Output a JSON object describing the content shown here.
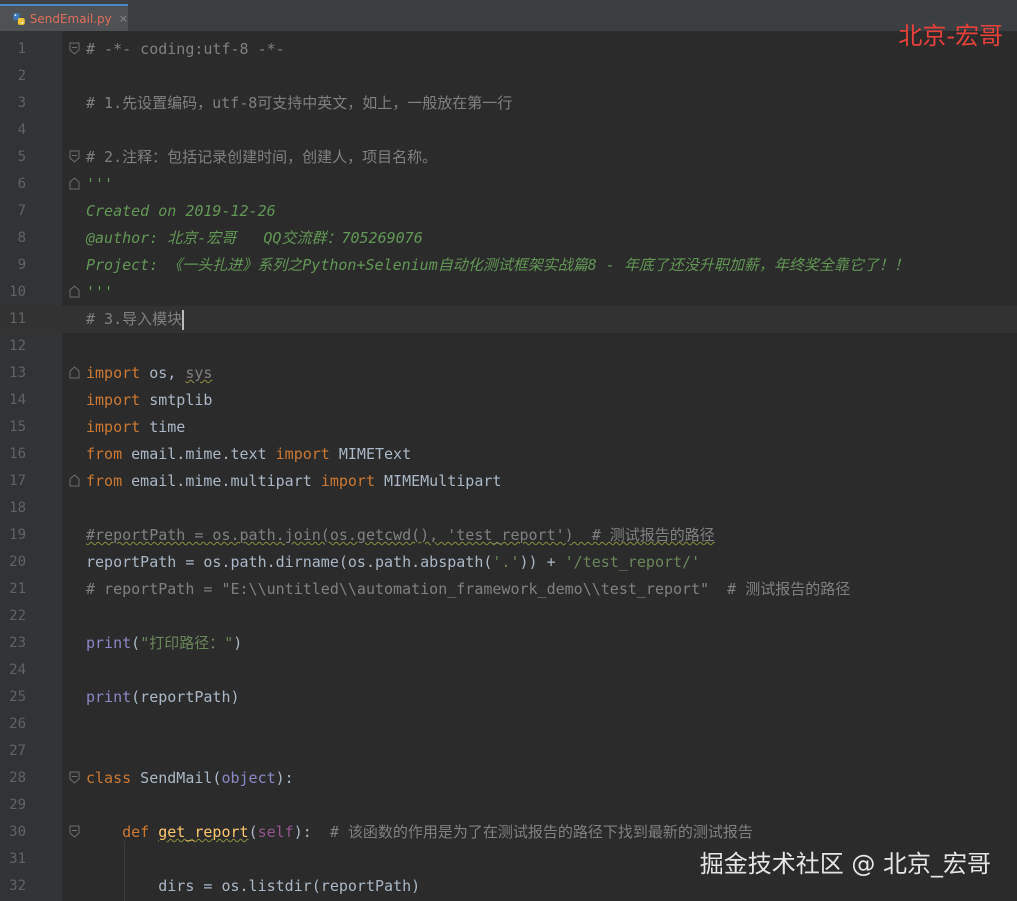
{
  "tab": {
    "filename": "SendEmail.py",
    "close": "×",
    "icon": "python-file-icon"
  },
  "watermark_top": "北京-宏哥",
  "watermark_bottom": "掘金技术社区 @ 北京_宏哥",
  "current_line": 11,
  "lines": [
    {
      "n": "1",
      "text": "# -*- coding:utf-8 -*-"
    },
    {
      "n": "2",
      "text": ""
    },
    {
      "n": "3",
      "text": "# 1.先设置编码，utf-8可支持中英文，如上，一般放在第一行"
    },
    {
      "n": "4",
      "text": ""
    },
    {
      "n": "5",
      "text": "# 2.注释：包括记录创建时间，创建人，项目名称。"
    },
    {
      "n": "6",
      "text": "'''"
    },
    {
      "n": "7",
      "text": "Created on 2019-12-26"
    },
    {
      "n": "8",
      "text": "@author: 北京-宏哥   QQ交流群：705269076"
    },
    {
      "n": "9",
      "text": "Project: 《一头扎进》系列之Python+Selenium自动化测试框架实战篇8 - 年底了还没升职加薪，年终奖全靠它了！！"
    },
    {
      "n": "10",
      "text": "'''"
    },
    {
      "n": "11",
      "text": "# 3.导入模块"
    },
    {
      "n": "12",
      "text": ""
    },
    {
      "n": "13",
      "text": "import os, sys"
    },
    {
      "n": "14",
      "text": "import smtplib"
    },
    {
      "n": "15",
      "text": "import time"
    },
    {
      "n": "16",
      "text": "from email.mime.text import MIMEText"
    },
    {
      "n": "17",
      "text": "from email.mime.multipart import MIMEMultipart"
    },
    {
      "n": "18",
      "text": ""
    },
    {
      "n": "19",
      "text": "#reportPath = os.path.join(os.getcwd(), 'test_report')  # 测试报告的路径"
    },
    {
      "n": "20",
      "text": "reportPath = os.path.dirname(os.path.abspath('.')) + '/test_report/'"
    },
    {
      "n": "21",
      "text": "# reportPath = \"E:\\\\untitled\\\\automation_framework_demo\\\\test_report\"  # 测试报告的路径"
    },
    {
      "n": "22",
      "text": ""
    },
    {
      "n": "23",
      "text": "print(\"打印路径：\")"
    },
    {
      "n": "24",
      "text": ""
    },
    {
      "n": "25",
      "text": "print(reportPath)"
    },
    {
      "n": "26",
      "text": ""
    },
    {
      "n": "27",
      "text": ""
    },
    {
      "n": "28",
      "text": "class SendMail(object):"
    },
    {
      "n": "29",
      "text": ""
    },
    {
      "n": "30",
      "text": "    def get_report(self):  # 该函数的作用是为了在测试报告的路径下找到最新的测试报告"
    },
    {
      "n": "31",
      "text": ""
    },
    {
      "n": "32",
      "text": "        dirs = os.listdir(reportPath)"
    }
  ]
}
